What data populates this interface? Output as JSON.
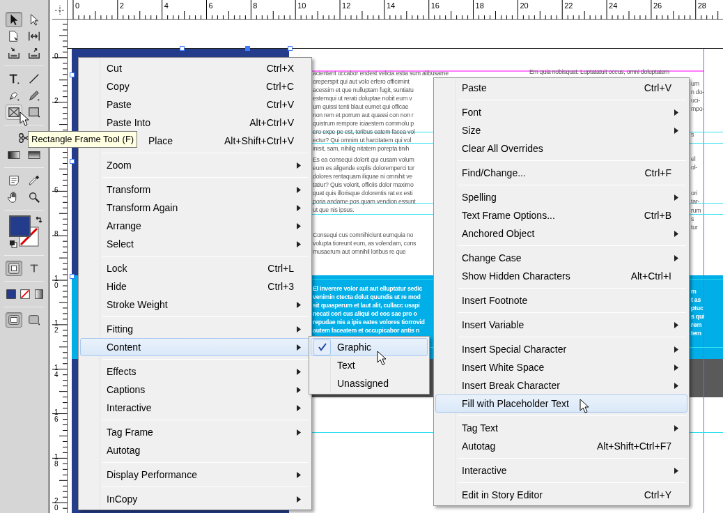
{
  "toolbox": {
    "tools": [
      {
        "selected": true,
        "hovered": false
      },
      {
        "selected": false,
        "hovered": false
      },
      {
        "selected": false,
        "hovered": false
      },
      {
        "selected": false,
        "hovered": false
      },
      {
        "selected": false,
        "hovered": false
      },
      {
        "selected": false,
        "hovered": false
      },
      {
        "selected": false,
        "hovered": false
      },
      {
        "selected": false,
        "hovered": false
      },
      {
        "selected": false,
        "hovered": false
      },
      {
        "selected": false,
        "hovered": false
      },
      {
        "selected": false,
        "hovered": true
      },
      {
        "selected": false,
        "hovered": false
      },
      {
        "selected": false,
        "hovered": false
      },
      {
        "selected": false,
        "hovered": false
      },
      {
        "selected": false,
        "hovered": false
      },
      {
        "selected": false,
        "hovered": false
      },
      {
        "selected": false,
        "hovered": false
      },
      {
        "selected": false,
        "hovered": false
      },
      {
        "selected": false,
        "hovered": false
      },
      {
        "selected": true,
        "hovered": false
      },
      {
        "selected": false,
        "hovered": false
      },
      {
        "selected": false,
        "hovered": false
      },
      {
        "selected": false,
        "hovered": false
      },
      {
        "selected": false,
        "hovered": false
      },
      {
        "selected": true,
        "hovered": false
      },
      {
        "selected": false,
        "hovered": false
      }
    ]
  },
  "tooltip": "Rectangle Frame Tool (F)",
  "rulers": {
    "horizontal": [
      "0",
      "2",
      "4",
      "6",
      "8",
      "10",
      "12",
      "14",
      "16",
      "18",
      "20",
      "22",
      "24",
      "26",
      "28"
    ],
    "vertical": [
      {
        "label": "0"
      },
      {
        "label": "2"
      },
      {
        "covered": true
      },
      {
        "label": "6"
      },
      {
        "label": "8"
      },
      {
        "label": "10"
      },
      {
        "label": "12"
      },
      {
        "label": "14"
      },
      {
        "label": "16"
      },
      {
        "label": "18"
      },
      {
        "label": "20"
      }
    ]
  },
  "document": {
    "left_column": [
      [
        "acientent occabor endest velicia estia sum alibusame",
        "oreperspit qui aut volo erfero officimint",
        "acessim et que nulluptam fugit, suntiatu",
        "estemqui ut rerati doluptae nobit eum v",
        "um quissi tenti blaut eumet qui officae",
        "non rem et porrum aut quassi con non r",
        "quistrum rempore iciaestem commolu p",
        "ero expe pe est, toribus eatem facea vol",
        "ectur? Qui omnim ut harcitatem qui vol",
        "inisit, sam, nihilig nitatem porepta tinih"
      ],
      [
        "Es ea consequi dolorit qui cusam volum",
        "eum es aligende explis doloremperci tor",
        "dolores reritaquam iliquae ni omnihit ve",
        "tatiur? Quis volorit, officiis dolor maximo",
        "quat quis illorisque dolorentis rat ex esti",
        "poria andame pos quam vendion essunt",
        "ut que nis ipsus."
      ],
      [
        "Consequi cus comnihiciunt eumquia no",
        "volupta tioreunt eum, as volendam, cons",
        "musaerum aut omnihil loribus re que"
      ]
    ],
    "band_text": [
      "El inverere volor aut aut elluptatur sedic",
      "venimin ctecta dolut quundis ut re mod",
      "sit quasperum et laut alit, cullacc usapi",
      "necati cori cus aliqui od eos sae pro o",
      "repudae nis a ipis eates volores tiorrovid",
      "autem faceatem et occupicabor antis n"
    ],
    "right_column_top": "Em quia nobisquat. Luptatatuit occus, omni doluptatem",
    "right_strip": [
      [
        "um",
        "n do-",
        "uci-",
        "mpo-"
      ],
      [
        "s"
      ],
      [
        "el",
        "ol-"
      ],
      [
        "ori",
        "tar-"
      ],
      [
        "rum",
        "s",
        "tur"
      ]
    ],
    "band_strip": [
      "m",
      "t as",
      "ptuc",
      "s qui",
      "rem",
      "tem"
    ]
  },
  "context_menu": {
    "items": [
      {
        "kind": "command",
        "label": "Cut",
        "shortcut": "Ctrl+X",
        "selected": false
      },
      {
        "kind": "command",
        "label": "Copy",
        "shortcut": "Ctrl+C",
        "selected": false
      },
      {
        "kind": "command",
        "label": "Paste",
        "shortcut": "Ctrl+V",
        "selected": false
      },
      {
        "kind": "command",
        "label": "Paste Into",
        "shortcut": "Alt+Ctrl+V",
        "selected": false
      },
      {
        "kind": "command",
        "label": "Place",
        "shortcut": "Alt+Shift+Ctrl+V",
        "selected": false,
        "covered": true
      },
      {
        "kind": "separator"
      },
      {
        "kind": "submenu",
        "label": "Zoom",
        "selected": false
      },
      {
        "kind": "separator"
      },
      {
        "kind": "submenu",
        "label": "Transform",
        "selected": false
      },
      {
        "kind": "submenu",
        "label": "Transform Again",
        "selected": false
      },
      {
        "kind": "submenu",
        "label": "Arrange",
        "selected": false
      },
      {
        "kind": "submenu",
        "label": "Select",
        "selected": false
      },
      {
        "kind": "separator"
      },
      {
        "kind": "command",
        "label": "Lock",
        "shortcut": "Ctrl+L",
        "selected": false
      },
      {
        "kind": "command",
        "label": "Hide",
        "shortcut": "Ctrl+3",
        "selected": false
      },
      {
        "kind": "submenu",
        "label": "Stroke Weight",
        "selected": false
      },
      {
        "kind": "separator"
      },
      {
        "kind": "submenu",
        "label": "Fitting",
        "selected": false
      },
      {
        "kind": "submenu",
        "label": "Content",
        "selected": true
      },
      {
        "kind": "separator"
      },
      {
        "kind": "submenu",
        "label": "Effects",
        "selected": false
      },
      {
        "kind": "submenu",
        "label": "Captions",
        "selected": false
      },
      {
        "kind": "submenu",
        "label": "Interactive",
        "selected": false
      },
      {
        "kind": "separator"
      },
      {
        "kind": "submenu",
        "label": "Tag Frame",
        "selected": false
      },
      {
        "kind": "command",
        "label": "Autotag",
        "selected": false
      },
      {
        "kind": "separator"
      },
      {
        "kind": "submenu",
        "label": "Display Performance",
        "selected": false
      },
      {
        "kind": "separator"
      },
      {
        "kind": "submenu",
        "label": "InCopy",
        "selected": false
      }
    ]
  },
  "content_submenu": {
    "items": [
      {
        "label": "Graphic",
        "checked": true,
        "selected": true
      },
      {
        "label": "Text",
        "checked": false,
        "selected": false
      },
      {
        "label": "Unassigned",
        "checked": false,
        "selected": false
      }
    ]
  },
  "text_menu": {
    "items": [
      {
        "kind": "command",
        "label": "Paste",
        "shortcut": "Ctrl+V",
        "selected": false
      },
      {
        "kind": "separator"
      },
      {
        "kind": "submenu",
        "label": "Font",
        "selected": false
      },
      {
        "kind": "submenu",
        "label": "Size",
        "selected": false
      },
      {
        "kind": "command",
        "label": "Clear All Overrides",
        "selected": false
      },
      {
        "kind": "separator"
      },
      {
        "kind": "command",
        "label": "Find/Change...",
        "shortcut": "Ctrl+F",
        "selected": false
      },
      {
        "kind": "separator"
      },
      {
        "kind": "submenu",
        "label": "Spelling",
        "selected": false
      },
      {
        "kind": "command",
        "label": "Text Frame Options...",
        "shortcut": "Ctrl+B",
        "selected": false
      },
      {
        "kind": "submenu",
        "label": "Anchored Object",
        "selected": false
      },
      {
        "kind": "separator"
      },
      {
        "kind": "submenu",
        "label": "Change Case",
        "selected": false
      },
      {
        "kind": "command",
        "label": "Show Hidden Characters",
        "shortcut": "Alt+Ctrl+I",
        "selected": false
      },
      {
        "kind": "separator"
      },
      {
        "kind": "command",
        "label": "Insert Footnote",
        "selected": false
      },
      {
        "kind": "separator"
      },
      {
        "kind": "submenu",
        "label": "Insert Variable",
        "selected": false
      },
      {
        "kind": "separator"
      },
      {
        "kind": "submenu",
        "label": "Insert Special Character",
        "selected": false
      },
      {
        "kind": "submenu",
        "label": "Insert White Space",
        "selected": false
      },
      {
        "kind": "submenu",
        "label": "Insert Break Character",
        "selected": false
      },
      {
        "kind": "command",
        "label": "Fill with Placeholder Text",
        "selected": true
      },
      {
        "kind": "separator"
      },
      {
        "kind": "submenu",
        "label": "Tag Text",
        "selected": false
      },
      {
        "kind": "command",
        "label": "Autotag",
        "shortcut": "Alt+Shift+Ctrl+F7",
        "selected": false
      },
      {
        "kind": "separator"
      },
      {
        "kind": "submenu",
        "label": "Interactive",
        "selected": false
      },
      {
        "kind": "separator"
      },
      {
        "kind": "command",
        "label": "Edit in Story Editor",
        "shortcut": "Ctrl+Y",
        "selected": false
      }
    ]
  }
}
